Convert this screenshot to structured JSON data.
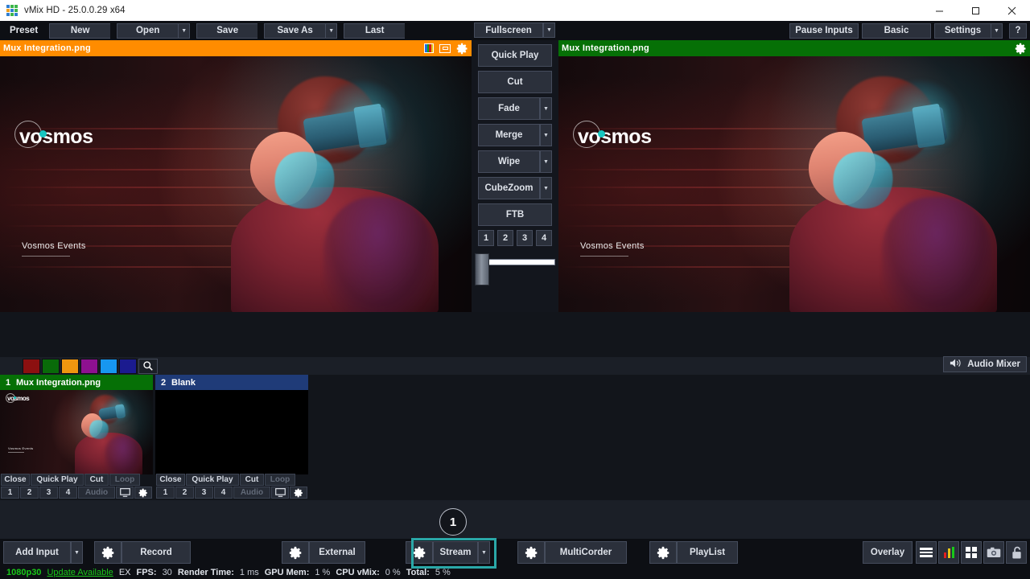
{
  "window": {
    "title": "vMix HD - 25.0.0.29 x64",
    "logo_colors": [
      "#2f7fd0",
      "#3bb54a",
      "#3bb54a",
      "#f0a020",
      "#2f7fd0",
      "#3bb54a",
      "#2f7fd0",
      "#3bb54a",
      "#2f7fd0"
    ],
    "controls": {
      "minimize": "minimize-icon",
      "maximize": "maximize-icon",
      "close": "close-icon"
    }
  },
  "menubar": {
    "preset_label": "Preset",
    "left_buttons": [
      {
        "label": "New",
        "has_arrow": false
      },
      {
        "label": "Open",
        "has_arrow": true
      },
      {
        "label": "Save",
        "has_arrow": false
      },
      {
        "label": "Save As",
        "has_arrow": true
      },
      {
        "label": "Last",
        "has_arrow": false
      }
    ],
    "center_button": {
      "label": "Fullscreen",
      "has_arrow": true
    },
    "right_buttons": [
      {
        "label": "Pause Inputs",
        "has_arrow": false
      },
      {
        "label": "Basic",
        "has_arrow": false
      },
      {
        "label": "Settings",
        "has_arrow": true
      },
      {
        "label": "?",
        "has_arrow": false
      }
    ]
  },
  "preview": {
    "title": "Mux Integration.png",
    "header_color": "#ff8c00",
    "icons": [
      "color-bars-icon",
      "overlay-screen-icon",
      "gear-icon"
    ],
    "logo_word": "vosmos",
    "overlay_text": "Vosmos Events"
  },
  "program": {
    "title": "Mux Integration.png",
    "header_color": "#067006",
    "icons": [
      "gear-icon"
    ],
    "logo_word": "vosmos",
    "overlay_text": "Vosmos Events"
  },
  "transitions": {
    "buttons": [
      {
        "label": "Quick Play",
        "has_arrow": false
      },
      {
        "label": "Cut",
        "has_arrow": false
      },
      {
        "label": "Fade",
        "has_arrow": true
      },
      {
        "label": "Merge",
        "has_arrow": true
      },
      {
        "label": "Wipe",
        "has_arrow": true
      },
      {
        "label": "CubeZoom",
        "has_arrow": true
      },
      {
        "label": "FTB",
        "has_arrow": false
      }
    ],
    "numbers": [
      "1",
      "2",
      "3",
      "4"
    ],
    "fader_value": 16,
    "fader_color": "#1a8fff"
  },
  "shortcuts": {
    "swatches": [
      "#8c1010",
      "#096b09",
      "#f0960f",
      "#8e1090",
      "#1797f0",
      "#1b1b8f"
    ],
    "search_icon": "search-icon"
  },
  "audio_mixer": {
    "label": "Audio Mixer",
    "icon": "speaker-icon"
  },
  "inputs": [
    {
      "number": "1",
      "title": "Mux Integration.png",
      "state_color": "#067006",
      "row1": [
        "Close",
        "Quick Play",
        "Cut",
        "Loop",
        ""
      ],
      "loop_disabled": true,
      "row2_numbers": [
        "1",
        "2",
        "3",
        "4"
      ],
      "row2_audio": "Audio",
      "row2_icons": [
        "monitor-icon",
        "gear-icon"
      ],
      "thumb_type": "image",
      "thumb_logo": "vosmos",
      "thumb_text": "Vosmos Events"
    },
    {
      "number": "2",
      "title": "Blank",
      "state_color": "#1f3b78",
      "row1": [
        "Close",
        "Quick Play",
        "Cut",
        "Loop",
        ""
      ],
      "loop_disabled": true,
      "row2_numbers": [
        "1",
        "2",
        "3",
        "4"
      ],
      "row2_audio": "Audio",
      "row2_icons": [
        "monitor-icon",
        "gear-icon"
      ],
      "thumb_type": "black",
      "thumb_logo": "",
      "thumb_text": ""
    }
  ],
  "bottombar": {
    "add_input": {
      "label": "Add Input",
      "has_arrow": true
    },
    "groups": [
      {
        "gear": "gear-icon",
        "label": "Record"
      },
      {
        "gear": "gear-icon",
        "label": "External"
      },
      {
        "gear": "gear-icon",
        "label": "Stream",
        "has_arrow": true,
        "highlighted": true
      },
      {
        "gear": "gear-icon",
        "label": "MultiCorder"
      },
      {
        "gear": "gear-icon",
        "label": "PlayList"
      }
    ],
    "overlay_label": "Overlay",
    "right_icons": [
      "hamburger-icon",
      "audio-levels-icon",
      "multiview-icon",
      "snapshot-icon",
      "lock-icon"
    ]
  },
  "callout": {
    "number": "1",
    "color": "#2aa8a8"
  },
  "statusbar": {
    "resolution": "1080p30",
    "update": "Update Available",
    "ex": "EX",
    "items": [
      {
        "key": "FPS:",
        "value": "30"
      },
      {
        "key": "Render Time:",
        "value": "1 ms"
      },
      {
        "key": "GPU Mem:",
        "value": "1 %"
      },
      {
        "key": "CPU vMix:",
        "value": "0 %"
      },
      {
        "key": "Total:",
        "value": "5 %"
      }
    ]
  }
}
